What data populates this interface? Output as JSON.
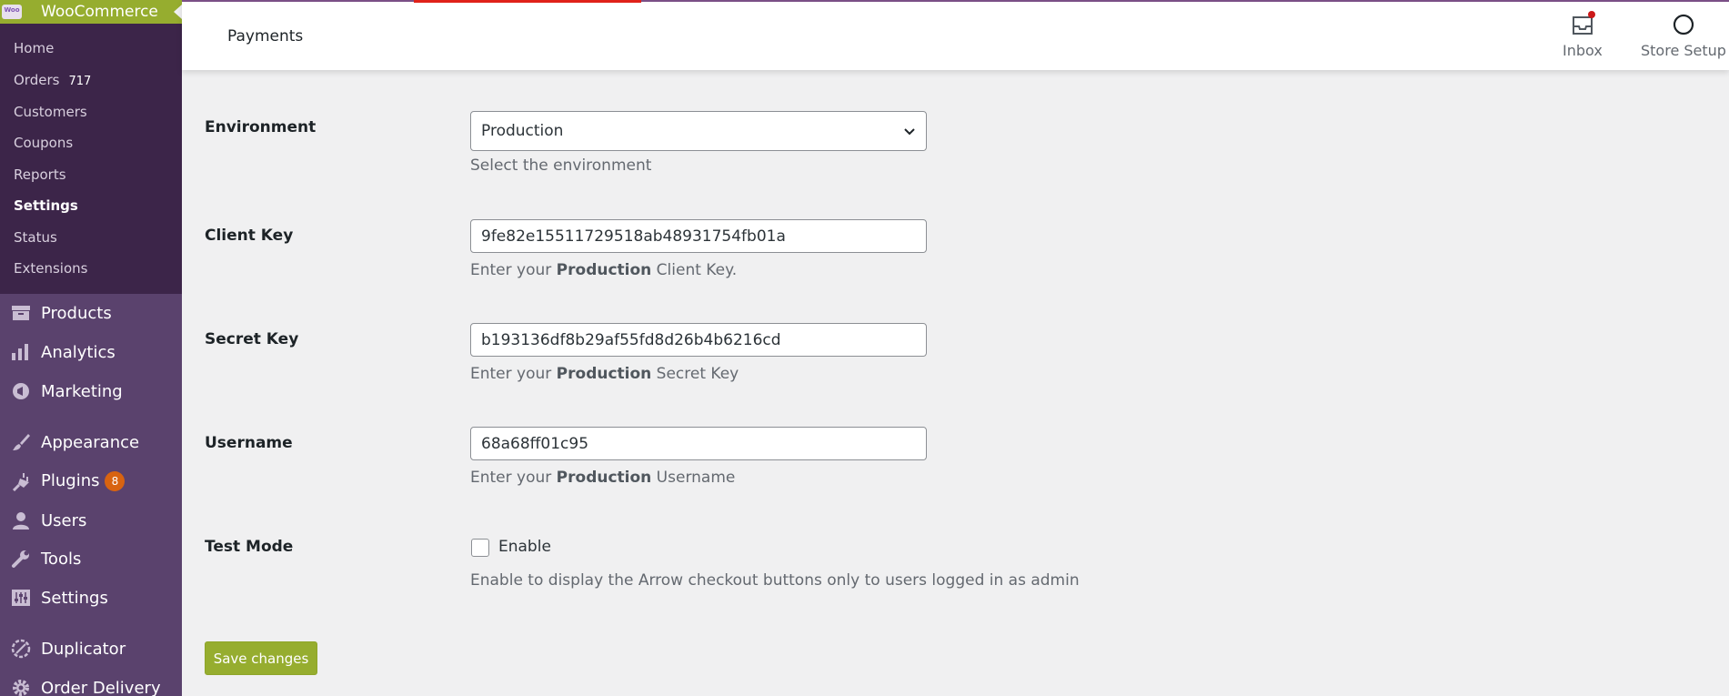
{
  "sidebar": {
    "brand": {
      "logo_text": "Woo",
      "title": "WooCommerce"
    },
    "submenu": [
      {
        "label": "Home"
      },
      {
        "label": "Orders",
        "badge": "717"
      },
      {
        "label": "Customers"
      },
      {
        "label": "Coupons"
      },
      {
        "label": "Reports"
      },
      {
        "label": "Settings",
        "current": true
      },
      {
        "label": "Status"
      },
      {
        "label": "Extensions"
      }
    ],
    "menu": [
      {
        "label": "Products",
        "icon": "archive-icon"
      },
      {
        "label": "Analytics",
        "icon": "bar-chart-icon"
      },
      {
        "label": "Marketing",
        "icon": "megaphone-icon"
      },
      {
        "label": "Appearance",
        "icon": "paintbrush-icon"
      },
      {
        "label": "Plugins",
        "icon": "plug-icon",
        "badge": "8"
      },
      {
        "label": "Users",
        "icon": "user-icon"
      },
      {
        "label": "Tools",
        "icon": "wrench-icon"
      },
      {
        "label": "Settings",
        "icon": "sliders-icon"
      },
      {
        "label": "Duplicator",
        "icon": "duplicator-icon"
      },
      {
        "label": "Order Delivery",
        "icon": "gear-icon"
      }
    ]
  },
  "header": {
    "title": "Payments",
    "inbox_label": "Inbox",
    "store_setup_label": "Store Setup"
  },
  "form": {
    "environment": {
      "label": "Environment",
      "value": "Production",
      "description": "Select the environment"
    },
    "client_key": {
      "label": "Client Key",
      "value": "9fe82e15511729518ab48931754fb01a",
      "desc_prefix": "Enter your ",
      "desc_bold": "Production",
      "desc_suffix": " Client Key."
    },
    "secret_key": {
      "label": "Secret Key",
      "value": "b193136df8b29af55fd8d26b4b6216cd",
      "desc_prefix": "Enter your ",
      "desc_bold": "Production",
      "desc_suffix": " Secret Key"
    },
    "username": {
      "label": "Username",
      "value": "68a68ff01c95",
      "desc_prefix": "Enter your ",
      "desc_bold": "Production",
      "desc_suffix": " Username"
    },
    "test_mode": {
      "label": "Test Mode",
      "checkbox_label": "Enable",
      "checked": false,
      "description": "Enable to display the Arrow checkout buttons only to users logged in as admin"
    },
    "save_label": "Save changes"
  },
  "colors": {
    "sidebar_bg": "#5a426d",
    "submenu_bg": "#3c2549",
    "woo_green": "#96ad2f",
    "badge_orange": "#d86310"
  }
}
